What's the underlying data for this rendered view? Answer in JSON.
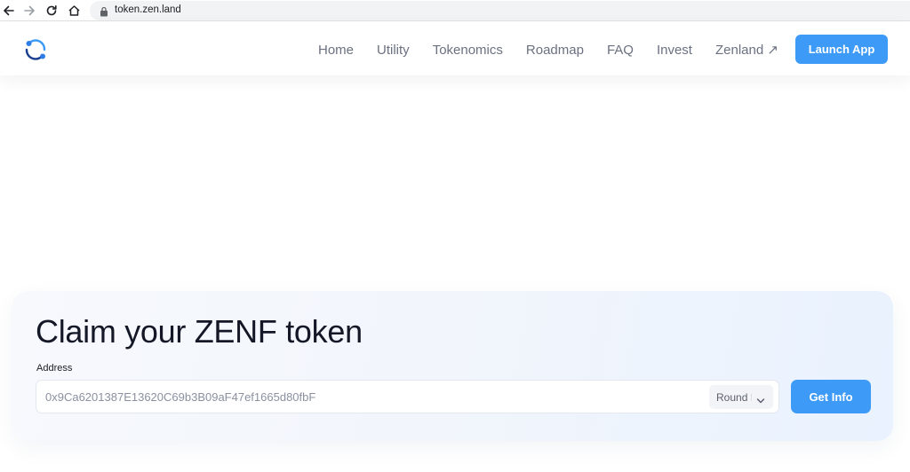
{
  "browser": {
    "url": "token.zen.land"
  },
  "header": {
    "nav": [
      {
        "label": "Home"
      },
      {
        "label": "Utility"
      },
      {
        "label": "Tokenomics"
      },
      {
        "label": "Roadmap"
      },
      {
        "label": "FAQ"
      },
      {
        "label": "Invest"
      },
      {
        "label": "Zenland ↗"
      }
    ],
    "launch_label": "Launch App"
  },
  "claim": {
    "title": "Claim your ZENF token",
    "address_label": "Address",
    "address_value": "0x9Ca6201387E13620C69b3B09aF47ef1665d80fbF",
    "round_selected": "Round I",
    "button_label": "Get Info"
  },
  "colors": {
    "accent": "#3d9bf7",
    "title": "#141726",
    "nav_text": "#6b7180"
  },
  "icons": {
    "back": "back-arrow-icon",
    "forward": "forward-arrow-icon",
    "reload": "reload-icon",
    "home": "home-icon",
    "lock": "lock-icon",
    "logo": "zenland-logo",
    "chevron": "chevron-down-icon"
  }
}
